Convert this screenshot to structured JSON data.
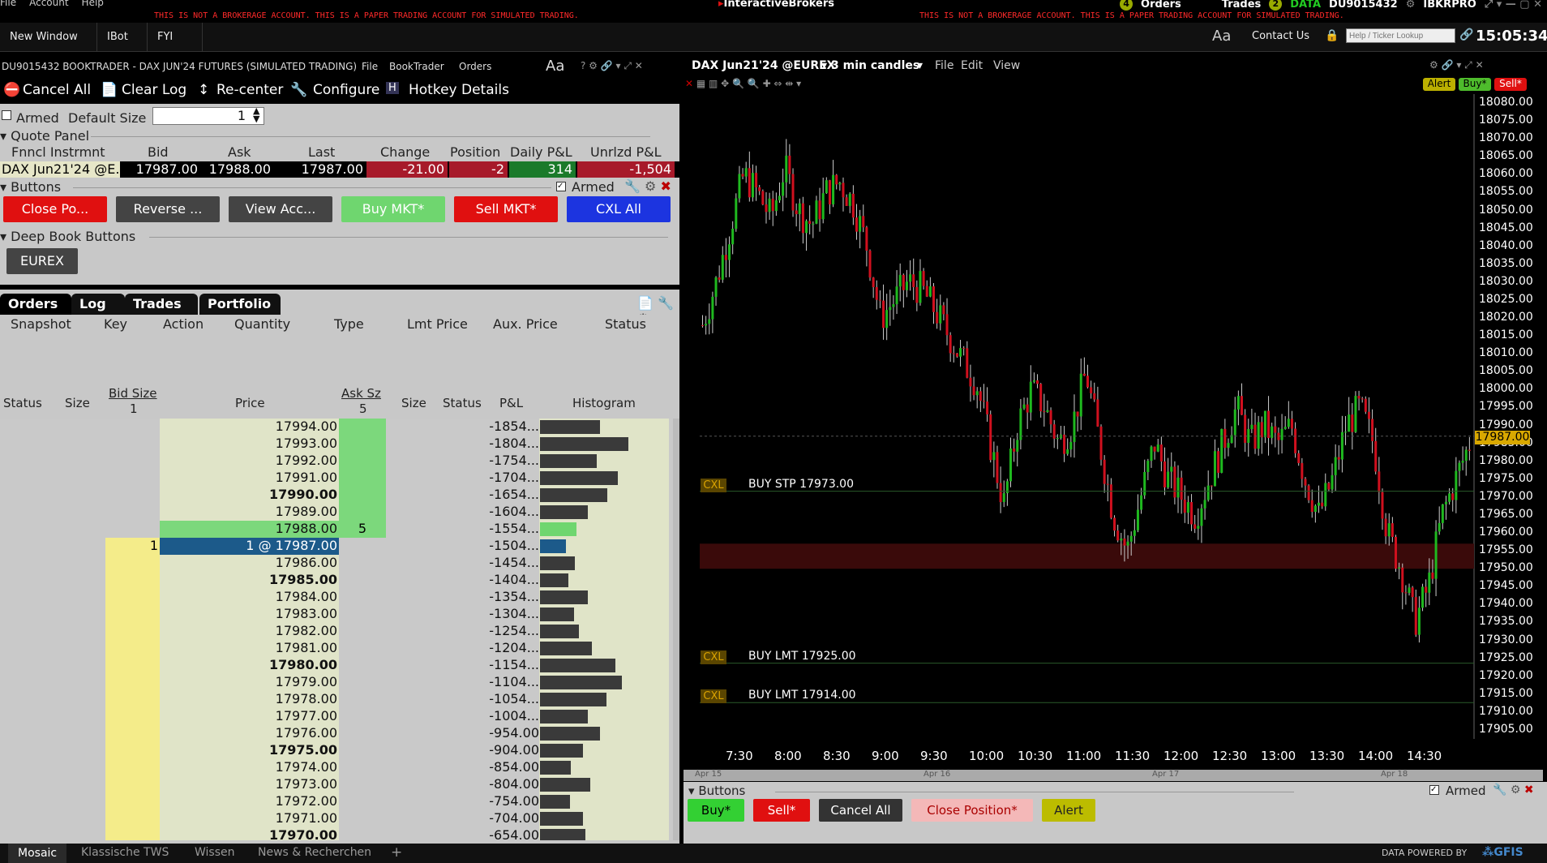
{
  "top": {
    "menu": [
      "File",
      "Account",
      "Help"
    ],
    "warning": "THIS IS NOT A BROKERAGE ACCOUNT. THIS IS A PAPER TRADING ACCOUNT FOR SIMULATED TRADING.",
    "brand": "InteractiveBrokers",
    "orders_count": "4",
    "orders_label": "Orders",
    "trades_label": "Trades",
    "data_count": "2",
    "data_label": "DATA",
    "account_id": "DU9015432",
    "product": "IBKRPRO"
  },
  "nav": {
    "tabs": [
      "New Window",
      "IBot",
      "FYI"
    ],
    "font_btn": "Aa",
    "contact": "Contact Us",
    "search_placeholder": "Help / Ticker Lookup",
    "clock": "15:05:34"
  },
  "booktrader": {
    "title": "DU9015432 BOOKTRADER - DAX JUN'24 FUTURES (SIMULATED TRADING)",
    "menus": [
      "File",
      "BookTrader",
      "Orders"
    ],
    "font_btn": "Aa",
    "toolbar": [
      "Cancel All",
      "Clear Log",
      "Re-center",
      "Configure",
      "Hotkey Details"
    ],
    "armed_label": "Armed",
    "default_size_label": "Default Size",
    "default_size": "1",
    "quote_panel": "Quote Panel",
    "quote_headers": [
      "Fnncl Instrmnt",
      "Bid",
      "Ask",
      "Last",
      "Change",
      "Position",
      "Daily P&L",
      "Unrlzd P&L"
    ],
    "quote": {
      "instrument": "DAX Jun21'24 @E...",
      "bid": "17987.00",
      "ask": "17988.00",
      "last": "17987.00",
      "change": "-21.00",
      "position": "-2",
      "daily_pnl": "314",
      "unrlzd_pnl": "-1,504"
    },
    "buttons_section": "Buttons",
    "buttons_armed": "Armed",
    "action_buttons": [
      "Close Po...",
      "Reverse ...",
      "View Acc...",
      "Buy MKT*",
      "Sell MKT*",
      "CXL All"
    ],
    "deep_book": "Deep Book Buttons",
    "exchange": "EUREX",
    "tabs": [
      "Orders",
      "Log",
      "Trades",
      "Portfolio"
    ],
    "order_headers": [
      "Snapshot",
      "Key",
      "Action",
      "Quantity",
      "Type",
      "Lmt Price",
      "Aux. Price",
      "Status"
    ],
    "ladder_headers": [
      "Status",
      "Size",
      "Bid Size",
      "Price",
      "Ask Sz",
      "Size",
      "Status",
      "P&L",
      "Histogram"
    ],
    "bid_size_total": "1",
    "ask_size_total": "5"
  },
  "ladder": [
    {
      "price": "17994.00",
      "pnl": "-1854...",
      "hist": 0.46,
      "bold": false,
      "ask": ""
    },
    {
      "price": "17993.00",
      "pnl": "-1804...",
      "hist": 0.68,
      "bold": false,
      "ask": ""
    },
    {
      "price": "17992.00",
      "pnl": "-1754...",
      "hist": 0.44,
      "bold": false,
      "ask": ""
    },
    {
      "price": "17991.00",
      "pnl": "-1704...",
      "hist": 0.6,
      "bold": false,
      "ask": ""
    },
    {
      "price": "17990.00",
      "pnl": "-1654...",
      "hist": 0.52,
      "bold": true,
      "ask": ""
    },
    {
      "price": "17989.00",
      "pnl": "-1604...",
      "hist": 0.37,
      "bold": false,
      "ask": ""
    },
    {
      "price": "17988.00",
      "pnl": "-1554...",
      "hist": 0.28,
      "bold": false,
      "ask": "5"
    },
    {
      "price": "1 @ 17987.00",
      "pnl": "-1504...",
      "hist": 0.2,
      "bold": false,
      "bid": "1"
    },
    {
      "price": "17986.00",
      "pnl": "-1454...",
      "hist": 0.27,
      "bold": false
    },
    {
      "price": "17985.00",
      "pnl": "-1404...",
      "hist": 0.22,
      "bold": true
    },
    {
      "price": "17984.00",
      "pnl": "-1354...",
      "hist": 0.37,
      "bold": false
    },
    {
      "price": "17983.00",
      "pnl": "-1304...",
      "hist": 0.26,
      "bold": false
    },
    {
      "price": "17982.00",
      "pnl": "-1254...",
      "hist": 0.3,
      "bold": false
    },
    {
      "price": "17981.00",
      "pnl": "-1204...",
      "hist": 0.4,
      "bold": false
    },
    {
      "price": "17980.00",
      "pnl": "-1154...",
      "hist": 0.58,
      "bold": true
    },
    {
      "price": "17979.00",
      "pnl": "-1104...",
      "hist": 0.63,
      "bold": false
    },
    {
      "price": "17978.00",
      "pnl": "-1054...",
      "hist": 0.51,
      "bold": false
    },
    {
      "price": "17977.00",
      "pnl": "-1004...",
      "hist": 0.37,
      "bold": false
    },
    {
      "price": "17976.00",
      "pnl": "-954.00",
      "hist": 0.46,
      "bold": false
    },
    {
      "price": "17975.00",
      "pnl": "-904.00",
      "hist": 0.33,
      "bold": true
    },
    {
      "price": "17974.00",
      "pnl": "-854.00",
      "hist": 0.24,
      "bold": false
    },
    {
      "price": "17973.00",
      "pnl": "-804.00",
      "hist": 0.39,
      "bold": false
    },
    {
      "price": "17972.00",
      "pnl": "-754.00",
      "hist": 0.23,
      "bold": false
    },
    {
      "price": "17971.00",
      "pnl": "-704.00",
      "hist": 0.33,
      "bold": false
    },
    {
      "price": "17970.00",
      "pnl": "-654.00",
      "hist": 0.35,
      "bold": true
    }
  ],
  "chart": {
    "symbol": "DAX Jun21'24 @EUREX",
    "interval": "3 min candles",
    "menus": [
      "File",
      "Edit",
      "View"
    ],
    "alert_btn": "Alert",
    "buy_btn": "Buy*",
    "sell_btn": "Sell*",
    "last_price": "17987.00",
    "y_ticks": [
      "18080.00",
      "18075.00",
      "18070.00",
      "18065.00",
      "18060.00",
      "18055.00",
      "18050.00",
      "18045.00",
      "18040.00",
      "18035.00",
      "18030.00",
      "18025.00",
      "18020.00",
      "18015.00",
      "18010.00",
      "18005.00",
      "18000.00",
      "17995.00",
      "17990.00",
      "17985.00",
      "17980.00",
      "17975.00",
      "17970.00",
      "17965.00",
      "17960.00",
      "17955.00",
      "17950.00",
      "17945.00",
      "17940.00",
      "17935.00",
      "17930.00",
      "17925.00",
      "17920.00",
      "17915.00",
      "17910.00",
      "17905.00"
    ],
    "x_ticks": [
      "7:30",
      "8:00",
      "8:30",
      "9:00",
      "9:30",
      "10:00",
      "10:30",
      "11:00",
      "11:30",
      "12:00",
      "12:30",
      "13:00",
      "13:30",
      "14:00",
      "14:30"
    ],
    "date_ticks": [
      "Apr 15",
      "Apr 16",
      "Apr 17",
      "Apr 18"
    ],
    "orders": [
      {
        "cxl": "CXL",
        "label": "BUY STP 17973.00",
        "price": 17973
      },
      {
        "cxl": "CXL",
        "label": "BUY LMT 17925.00",
        "price": 17925
      },
      {
        "cxl": "CXL",
        "label": "BUY LMT 17914.00",
        "price": 17914
      }
    ],
    "buttons_section": "Buttons",
    "armed": "Armed",
    "bottom_buttons": [
      "Buy*",
      "Sell*",
      "Cancel All",
      "Close Position*",
      "Alert"
    ],
    "colors": {
      "up": "#1fb91f",
      "down": "#d0101e",
      "bg": "#000000"
    }
  },
  "status": {
    "tabs": [
      "Mosaic",
      "Klassische TWS",
      "Wissen",
      "News & Recherchen"
    ],
    "add": "+",
    "data_by": "DATA POWERED BY",
    "gfis": "GFIS"
  }
}
